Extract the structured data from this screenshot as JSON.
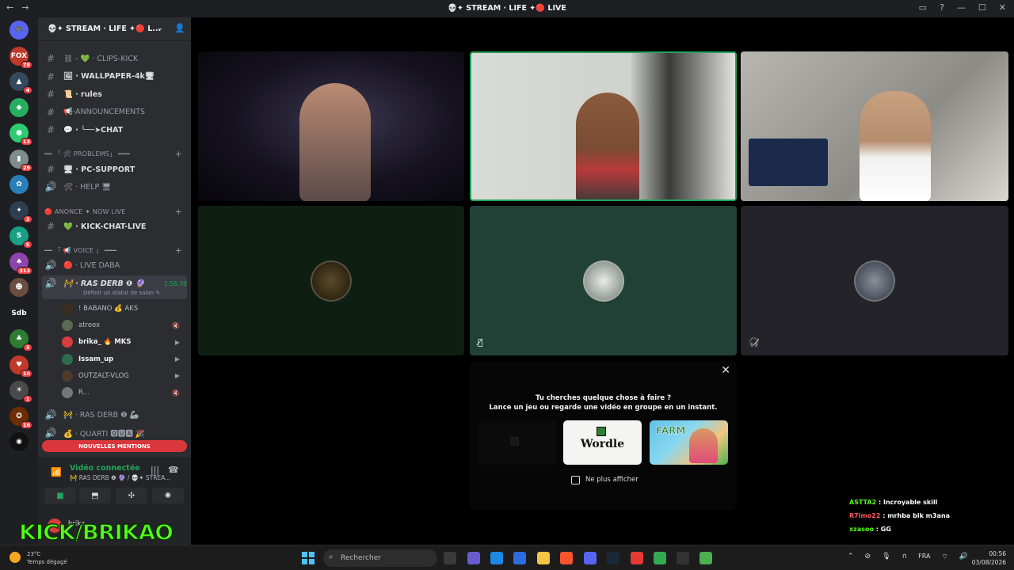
{
  "window": {
    "title": "💀✦ STREAM · LIFE ✦🔴 LIVE"
  },
  "server": {
    "name": "💀✦ STREAM · LIFE ✦🔴 L..."
  },
  "guilds": [
    {
      "label": "🎮",
      "color": "#5865f2",
      "badge": ""
    },
    {
      "label": "FOX",
      "color": "#c0392b",
      "badge": "78"
    },
    {
      "label": "▲",
      "color": "#34495e",
      "badge": "4"
    },
    {
      "label": "◆",
      "color": "#27ae60",
      "badge": ""
    },
    {
      "label": "●",
      "color": "#2ecc71",
      "badge": "13"
    },
    {
      "label": "▮",
      "color": "#7f8c8d",
      "badge": "29"
    },
    {
      "label": "✿",
      "color": "#2980b9",
      "badge": ""
    },
    {
      "label": "✦",
      "color": "#2c3e50",
      "badge": "3"
    },
    {
      "label": "S",
      "color": "#16a085",
      "badge": "5"
    },
    {
      "label": "♠",
      "color": "#8e44ad",
      "badge": "313"
    },
    {
      "label": "☻",
      "color": "#6d4c41",
      "badge": ""
    },
    {
      "label": "Sdb",
      "color": "#1e1f22",
      "badge": ""
    },
    {
      "label": "♣",
      "color": "#2e7d32",
      "badge": "3"
    },
    {
      "label": "♥",
      "color": "#c0392b",
      "badge": "10"
    },
    {
      "label": "☀",
      "color": "#4a4a4a",
      "badge": "1"
    },
    {
      "label": "✪",
      "color": "#6e2c00",
      "badge": "16"
    },
    {
      "label": "◉",
      "color": "#111",
      "badge": ""
    }
  ],
  "channels": [
    {
      "icon": "#",
      "name": "⛓ - 💚 · CLIPS-KICK",
      "bold": false
    },
    {
      "icon": "#",
      "name": "🖼 · WALLPAPER-4k🖥",
      "bold": true
    },
    {
      "icon": "#",
      "name": "📜 · rules",
      "bold": true
    },
    {
      "icon": "#",
      "name": "📢-ANNOUNCEMENTS",
      "bold": false
    },
    {
      "icon": "#",
      "name": "💬 · ╰──➤CHAT",
      "bold": true
    }
  ],
  "cat1": "━━ 「 🛠 PROBLEMS」 ━━━",
  "channels2": [
    {
      "icon": "#",
      "name": "🖥 · PC-SUPPORT",
      "bold": true
    },
    {
      "icon": "🔊",
      "name": "🛠 · HELP 🖥",
      "bold": false
    }
  ],
  "cat2": "🔴 ANONCE ✦ NOW LIVE ",
  "channels3": [
    {
      "icon": "#",
      "name": "💚 · KICK-CHAT-LIVE",
      "bold": true
    }
  ],
  "cat3": "━━ 「 📢 VOICE 」 ━━━",
  "voice_channels": [
    {
      "icon": "🔊",
      "name": "🔴 · LIVE DABA",
      "bold": false
    }
  ],
  "active_voice": {
    "name": "🚧 · RAS DERB ❶ 🔮",
    "timer": "1:56:39",
    "status": "Définir un statut de salon ✎"
  },
  "members": [
    {
      "name": "! BABANO 💰 AKS",
      "color": "#3b2e1e",
      "icon": ""
    },
    {
      "name": "atreex",
      "color": "#5a6b50",
      "icon": "🔇"
    },
    {
      "name": "brika_ 🔥 MKS",
      "color": "#d83c3e",
      "icon": "▶"
    },
    {
      "name": "Issam_up",
      "color": "#2f6b4f",
      "icon": "▶"
    },
    {
      "name": "OUTZALT-VLOG",
      "color": "#4d3b2b",
      "icon": "▶"
    },
    {
      "name": "R...",
      "color": "#777",
      "icon": "🔇"
    }
  ],
  "voice_channels2": [
    {
      "icon": "🔊",
      "name": "🚧 · RAS DERB ❷ 🦾",
      "bold": false
    },
    {
      "icon": "🔊",
      "name": "💰 · QUARTI 🆀🆄🅰 🎉",
      "bold": false
    }
  ],
  "mentions_label": "NOUVELLES MENTIONS",
  "voice_panel": {
    "title": "Vidéo connectée",
    "subtitle": "🚧 RAS DERB ❶ 🔮 / 💀✦ STREA...",
    "user": "brika_"
  },
  "activity": {
    "line1": "Tu cherches quelque chose à faire ?",
    "line2": "Lance un jeu ou regarde une vidéo en groupe en un instant.",
    "wordle": "Wordle",
    "farm": "FARM",
    "dont_show": "Ne plus afficher"
  },
  "kick_chat": [
    {
      "user": "ASTTA2",
      "msg": "Incroyable skill",
      "style": "u"
    },
    {
      "user": "R7imo22",
      "msg": "mrhba bik m3ana",
      "style": "u2"
    },
    {
      "user": "xzasoo",
      "msg": "GG",
      "style": "u"
    }
  ],
  "kick_logo": "KICK/BRIKAO",
  "taskbar": {
    "search": "Rechercher",
    "weather_temp": "23°C",
    "weather_text": "Temps dégagé",
    "lang": "FRA",
    "time": "00:56",
    "date": "03/08/2026"
  }
}
